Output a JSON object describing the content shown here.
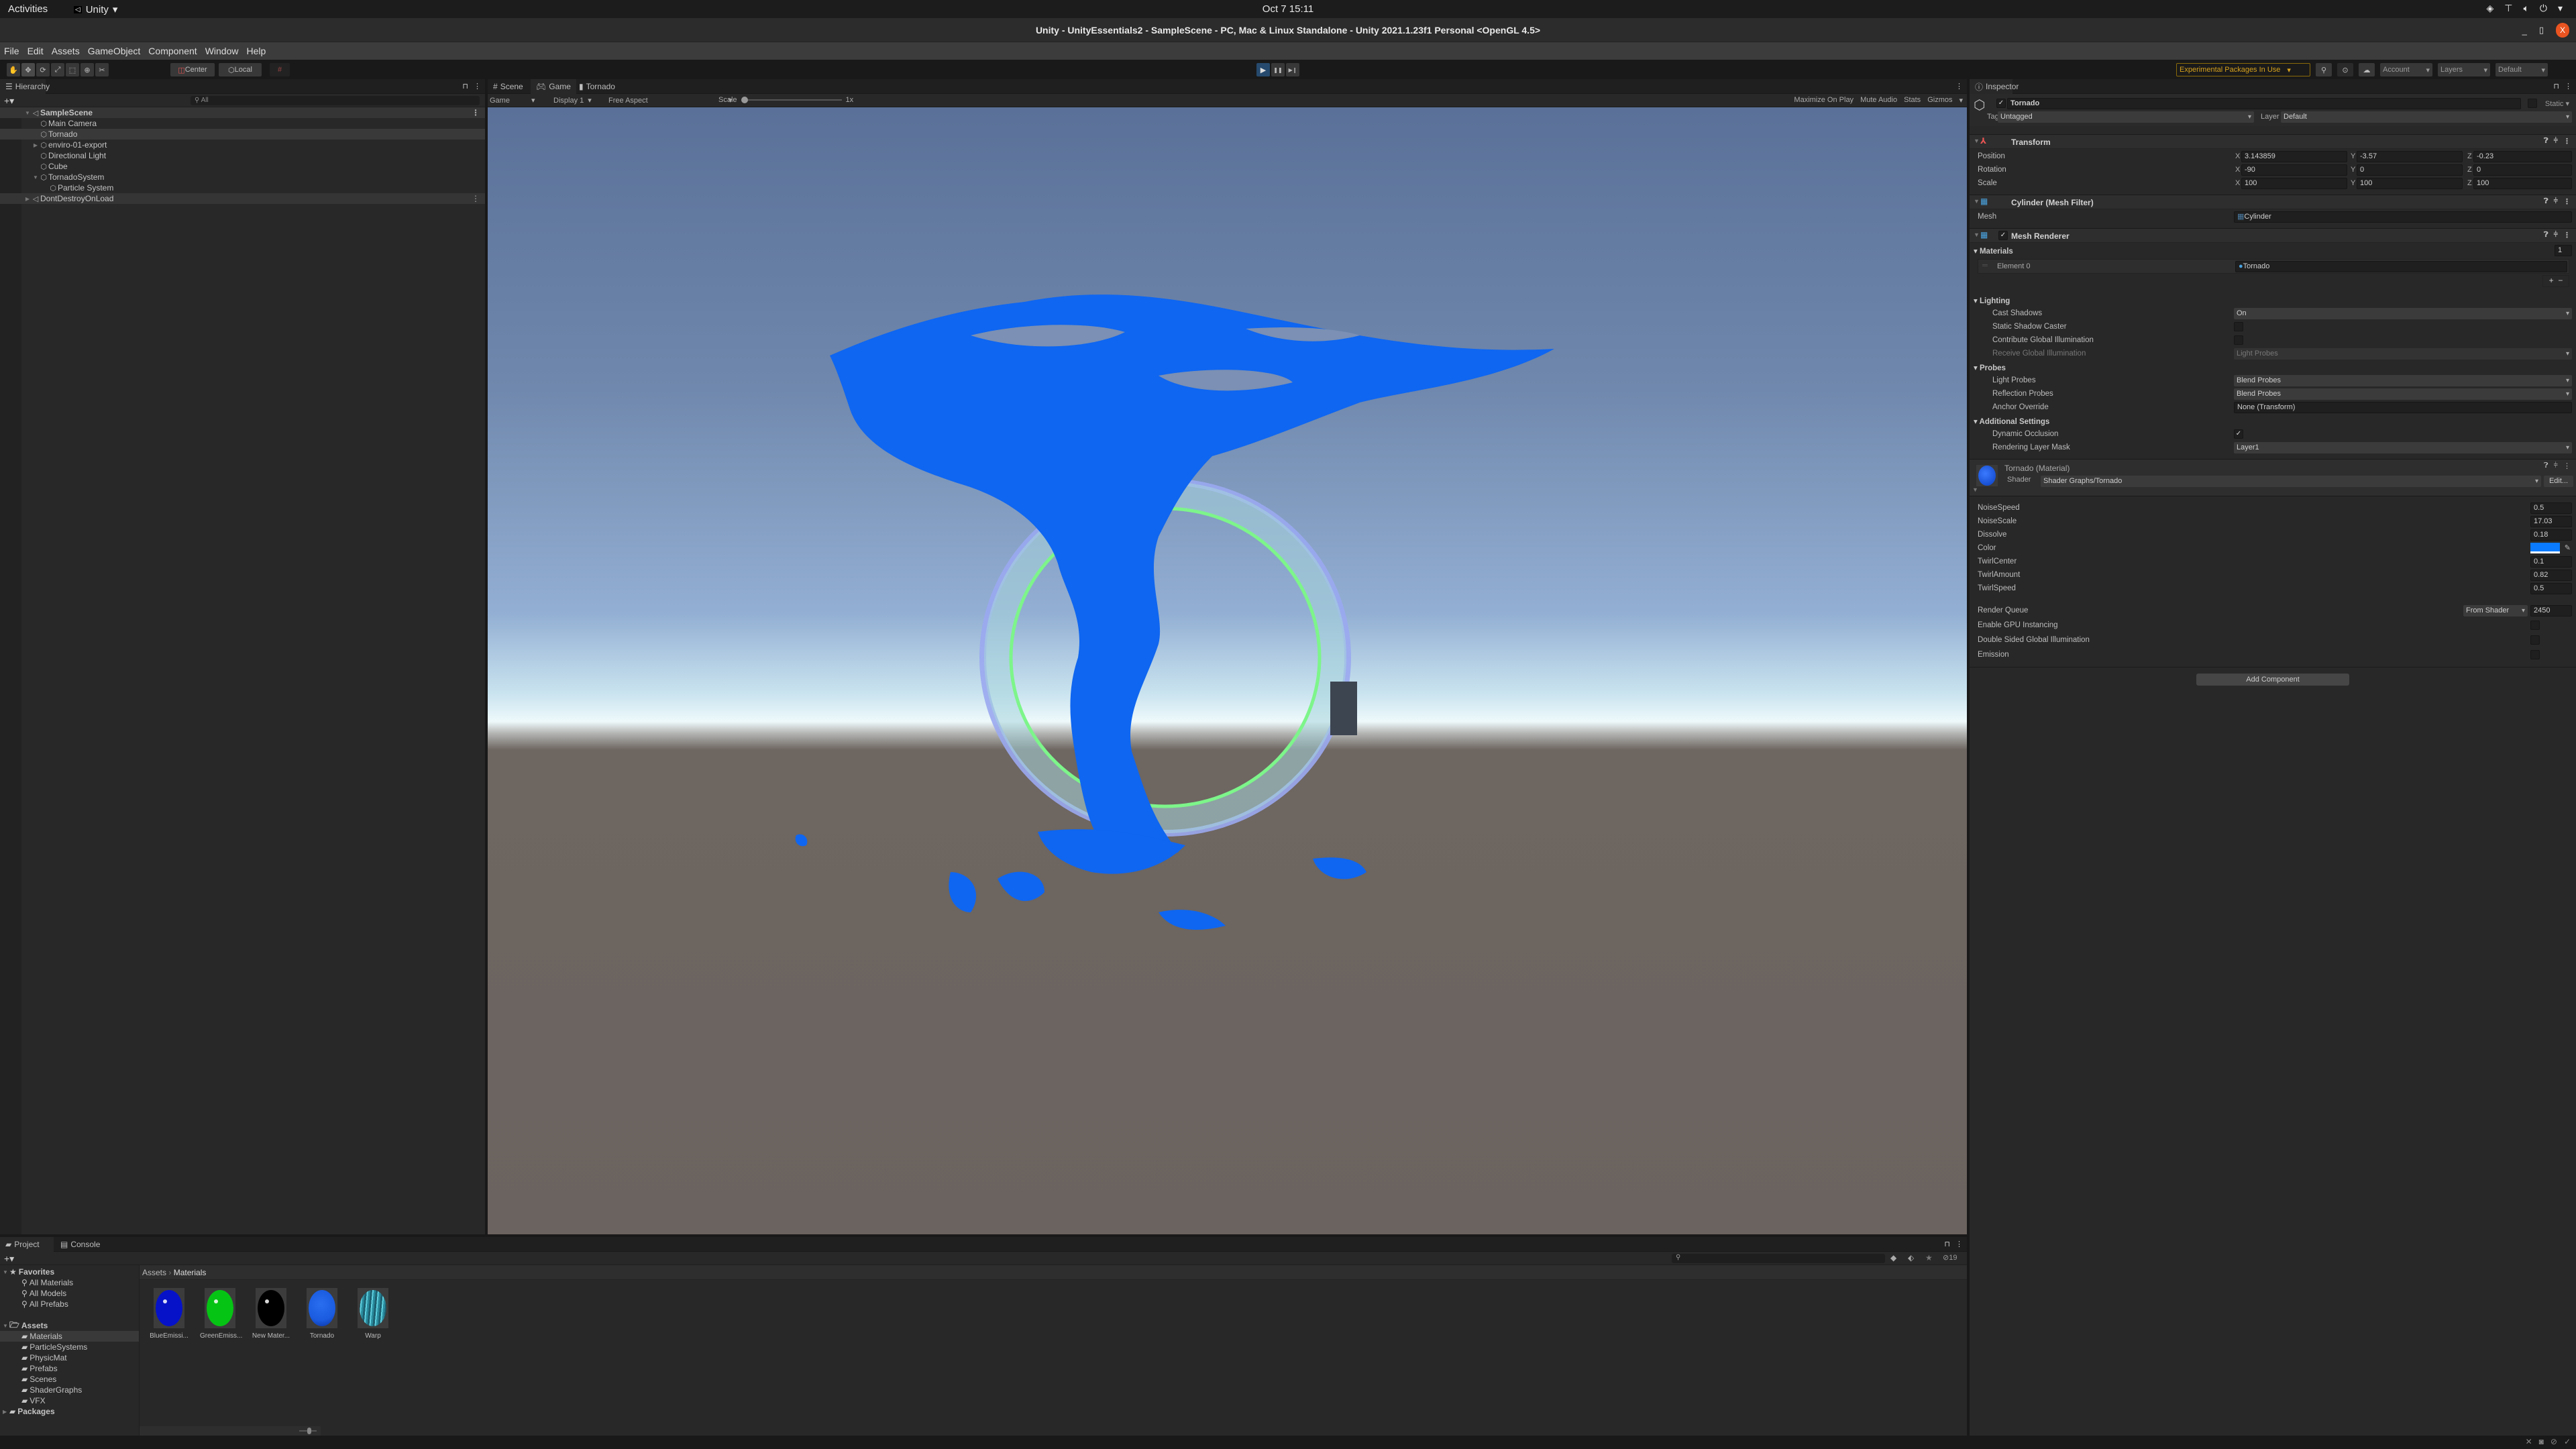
{
  "gnome": {
    "activities": "Activities",
    "app_name": "Unity",
    "app_menu_arrow": "▾",
    "clock": "Oct 7  15:11",
    "tray_icons": [
      "unity-hub-icon",
      "network-icon",
      "volume-icon",
      "power-icon"
    ]
  },
  "window": {
    "title": "Unity - UnityEssentials2 - SampleScene - PC, Mac & Linux Standalone - Unity 2021.1.23f1 Personal <OpenGL 4.5>",
    "minimize": "_",
    "maximize": "▯",
    "close": "X"
  },
  "menu": [
    "File",
    "Edit",
    "Assets",
    "GameObject",
    "Component",
    "Window",
    "Help"
  ],
  "toolbar": {
    "tools": [
      {
        "name": "hand-tool",
        "glyph": "✋"
      },
      {
        "name": "move-tool",
        "glyph": "✥"
      },
      {
        "name": "rotate-tool",
        "glyph": "⟳"
      },
      {
        "name": "scale-tool",
        "glyph": "⤢"
      },
      {
        "name": "rect-tool",
        "glyph": "⬚"
      },
      {
        "name": "transform-tool",
        "glyph": "⊕"
      },
      {
        "name": "custom-tool",
        "glyph": "✂"
      }
    ],
    "pivot": "Center",
    "space": "Local",
    "snap_glyph": "#",
    "play": "▶",
    "pause": "❚❚",
    "step": "▶❙",
    "experimental": "Experimental Packages In Use",
    "account": "Account",
    "layers": "Layers",
    "layout": "Default"
  },
  "hierarchy": {
    "tab": "Hierarchy",
    "search_placeholder": "All",
    "items": [
      {
        "label": "SampleScene",
        "depth": 0,
        "type": "scene",
        "expanded": true
      },
      {
        "label": "Main Camera",
        "depth": 1
      },
      {
        "label": "Tornado",
        "depth": 1,
        "selected": true
      },
      {
        "label": "enviro-01-export",
        "depth": 1,
        "collapsed": true
      },
      {
        "label": "Directional Light",
        "depth": 1
      },
      {
        "label": "Cube",
        "depth": 1
      },
      {
        "label": "TornadoSystem",
        "depth": 1,
        "expanded": true
      },
      {
        "label": "Particle System",
        "depth": 2
      },
      {
        "label": "DontDestroyOnLoad",
        "depth": 0,
        "type": "scene",
        "collapsed": true
      }
    ]
  },
  "game_view": {
    "tabs": [
      "Scene",
      "Game",
      "Tornado"
    ],
    "active_tab": "Game",
    "mode": "Game",
    "display": "Display 1",
    "aspect": "Free Aspect",
    "scale_label": "Scale",
    "scale_value": "1x",
    "maximize_on_play": "Maximize On Play",
    "mute_audio": "Mute Audio",
    "stats": "Stats",
    "gizmos": "Gizmos",
    "tornado_color": "#0f66f0"
  },
  "inspector": {
    "tab": "Inspector",
    "object_name": "Tornado",
    "active": true,
    "static_label": "Static",
    "tag_label": "Tag",
    "tag": "Untagged",
    "layer_label": "Layer",
    "layer": "Default",
    "transform": {
      "title": "Transform",
      "rows": [
        {
          "label": "Position",
          "x": "3.143859",
          "y": "-3.57",
          "z": "-0.23"
        },
        {
          "label": "Rotation",
          "x": "-90",
          "y": "0",
          "z": "0"
        },
        {
          "label": "Scale",
          "x": "100",
          "y": "100",
          "z": "100"
        }
      ]
    },
    "mesh_filter": {
      "title": "Cylinder (Mesh Filter)",
      "mesh_label": "Mesh",
      "mesh": "Cylinder"
    },
    "mesh_renderer": {
      "title": "Mesh Renderer",
      "enabled": true,
      "materials_label": "Materials",
      "materials_count": "1",
      "element_label": "Element 0",
      "element_value": "Tornado",
      "lighting_label": "Lighting",
      "cast_shadows_label": "Cast Shadows",
      "cast_shadows": "On",
      "static_shadow_caster_label": "Static Shadow Caster",
      "static_shadow_caster": false,
      "contribute_gi_label": "Contribute Global Illumination",
      "contribute_gi": false,
      "receive_gi_label": "Receive Global Illumination",
      "receive_gi": "Light Probes",
      "probes_label": "Probes",
      "light_probes_label": "Light Probes",
      "light_probes": "Blend Probes",
      "reflection_probes_label": "Reflection Probes",
      "reflection_probes": "Blend Probes",
      "anchor_override_label": "Anchor Override",
      "anchor_override": "None (Transform)",
      "additional_label": "Additional Settings",
      "dynamic_occlusion_label": "Dynamic Occlusion",
      "dynamic_occlusion": true,
      "rendering_layer_mask_label": "Rendering Layer Mask",
      "rendering_layer_mask": "Layer1"
    },
    "material": {
      "title": "Tornado (Material)",
      "shader_label": "Shader",
      "shader": "Shader Graphs/Tornado",
      "edit": "Edit...",
      "properties": [
        {
          "label": "NoiseSpeed",
          "value": "0.5"
        },
        {
          "label": "NoiseScale",
          "value": "17.03"
        },
        {
          "label": "Dissolve",
          "value": "0.18"
        },
        {
          "label": "Color",
          "color": "#0a7bff"
        },
        {
          "label": "TwirlCenter",
          "value": "0.1"
        },
        {
          "label": "TwirlAmount",
          "value": "0.82"
        },
        {
          "label": "TwirlSpeed",
          "value": "0.5"
        }
      ],
      "render_queue_label": "Render Queue",
      "render_queue_mode": "From Shader",
      "render_queue": "2450",
      "gpu_instancing_label": "Enable GPU Instancing",
      "gpu_instancing": false,
      "double_sided_gi_label": "Double Sided Global Illumination",
      "double_sided_gi": false,
      "emission_label": "Emission",
      "emission": false
    },
    "add_component": "Add Component"
  },
  "project": {
    "tabs": [
      "Project",
      "Console"
    ],
    "active_tab": "Project",
    "hidden_count": "19",
    "tree": [
      {
        "label": "Favorites",
        "type": "group",
        "icon": "star"
      },
      {
        "label": "All Materials",
        "type": "search"
      },
      {
        "label": "All Models",
        "type": "search"
      },
      {
        "label": "All Prefabs",
        "type": "search"
      },
      {
        "label": "Assets",
        "type": "group",
        "icon": "folder-open"
      },
      {
        "label": "Materials",
        "type": "folder",
        "selected": true
      },
      {
        "label": "ParticleSystems",
        "type": "folder"
      },
      {
        "label": "PhysicMat",
        "type": "folder"
      },
      {
        "label": "Prefabs",
        "type": "folder"
      },
      {
        "label": "Scenes",
        "type": "folder"
      },
      {
        "label": "ShaderGraphs",
        "type": "folder"
      },
      {
        "label": "VFX",
        "type": "folder"
      },
      {
        "label": "Packages",
        "type": "group",
        "icon": "folder"
      }
    ],
    "breadcrumb": [
      "Assets",
      "Materials"
    ],
    "assets": [
      {
        "label": "BlueEmissi...",
        "color": "#0512c8"
      },
      {
        "label": "GreenEmiss...",
        "color": "#06c414"
      },
      {
        "label": "New Mater...",
        "color": "#000000"
      },
      {
        "label": "Tornado",
        "color": "#1a5be0"
      },
      {
        "label": "Warp",
        "color": "#2a8c9e"
      }
    ]
  }
}
